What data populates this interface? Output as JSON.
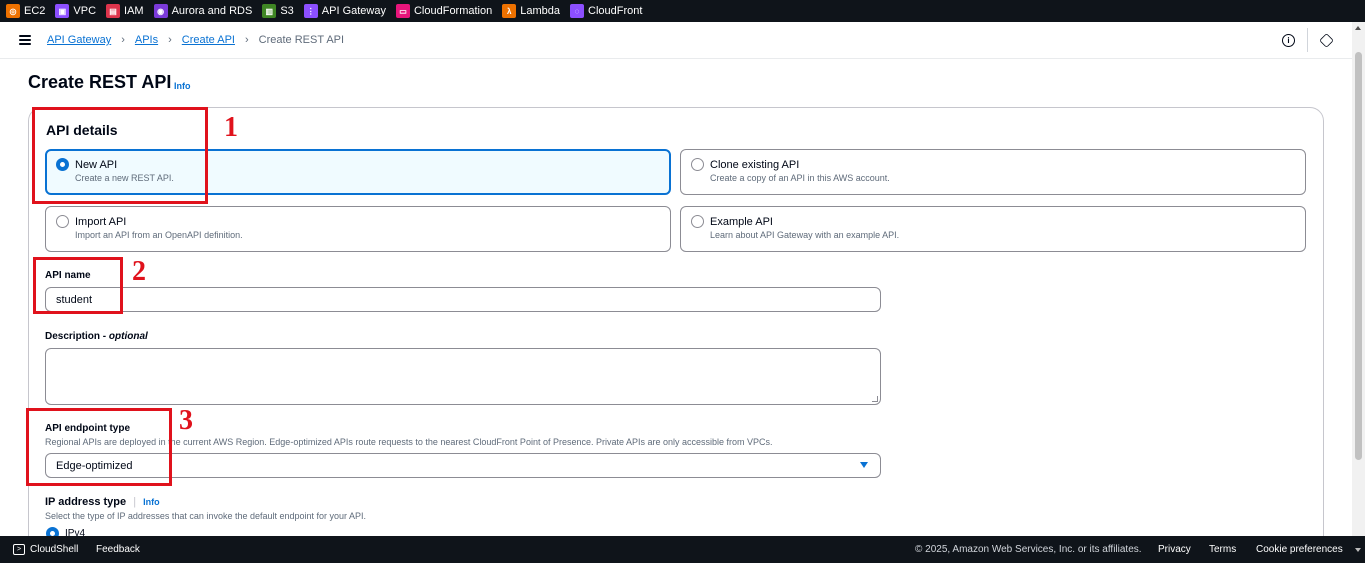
{
  "services": [
    {
      "label": "EC2",
      "color": "#ed7100",
      "icon": "ec2-icon"
    },
    {
      "label": "VPC",
      "color": "#8c4fff",
      "icon": "vpc-icon"
    },
    {
      "label": "IAM",
      "color": "#dd344c",
      "icon": "iam-icon"
    },
    {
      "label": "Aurora and RDS",
      "color": "#7b3ad9",
      "icon": "rds-icon"
    },
    {
      "label": "S3",
      "color": "#3f8624",
      "icon": "s3-icon"
    },
    {
      "label": "API Gateway",
      "color": "#8c4fff",
      "icon": "api-gateway-icon"
    },
    {
      "label": "CloudFormation",
      "color": "#e7157b",
      "icon": "cloudformation-icon"
    },
    {
      "label": "Lambda",
      "color": "#ed7100",
      "icon": "lambda-icon"
    },
    {
      "label": "CloudFront",
      "color": "#8c4fff",
      "icon": "cloudfront-icon"
    }
  ],
  "breadcrumb": {
    "items": [
      "API Gateway",
      "APIs",
      "Create API"
    ],
    "current": "Create REST API"
  },
  "page": {
    "title": "Create REST API",
    "info": "Info"
  },
  "api_details": {
    "heading": "API details",
    "options": [
      {
        "title": "New API",
        "desc": "Create a new REST API.",
        "selected": true
      },
      {
        "title": "Clone existing API",
        "desc": "Create a copy of an API in this AWS account.",
        "selected": false
      },
      {
        "title": "Import API",
        "desc": "Import an API from an OpenAPI definition.",
        "selected": false
      },
      {
        "title": "Example API",
        "desc": "Learn about API Gateway with an example API.",
        "selected": false
      }
    ]
  },
  "form": {
    "api_name_label": "API name",
    "api_name_value": "student",
    "description_label": "Description",
    "description_optional": "optional",
    "description_sep": " - ",
    "endpoint_label": "API endpoint type",
    "endpoint_hint": "Regional APIs are deployed in the current AWS Region. Edge-optimized APIs route requests to the nearest CloudFront Point of Presence. Private APIs are only accessible from VPCs.",
    "endpoint_value": "Edge-optimized",
    "ip_label": "IP address type",
    "ip_info": "Info",
    "ip_hint": "Select the type of IP addresses that can invoke the default endpoint for your API.",
    "ip_option": "IPv4"
  },
  "annotations": [
    "1",
    "2",
    "3"
  ],
  "footer": {
    "cloudshell": "CloudShell",
    "feedback": "Feedback",
    "copyright": "© 2025, Amazon Web Services, Inc. or its affiliates.",
    "privacy": "Privacy",
    "terms": "Terms",
    "cookies": "Cookie preferences"
  },
  "colors": {
    "accent": "#0972d3",
    "annotation_red": "#e0121c",
    "nav_bg": "#0f141a"
  }
}
